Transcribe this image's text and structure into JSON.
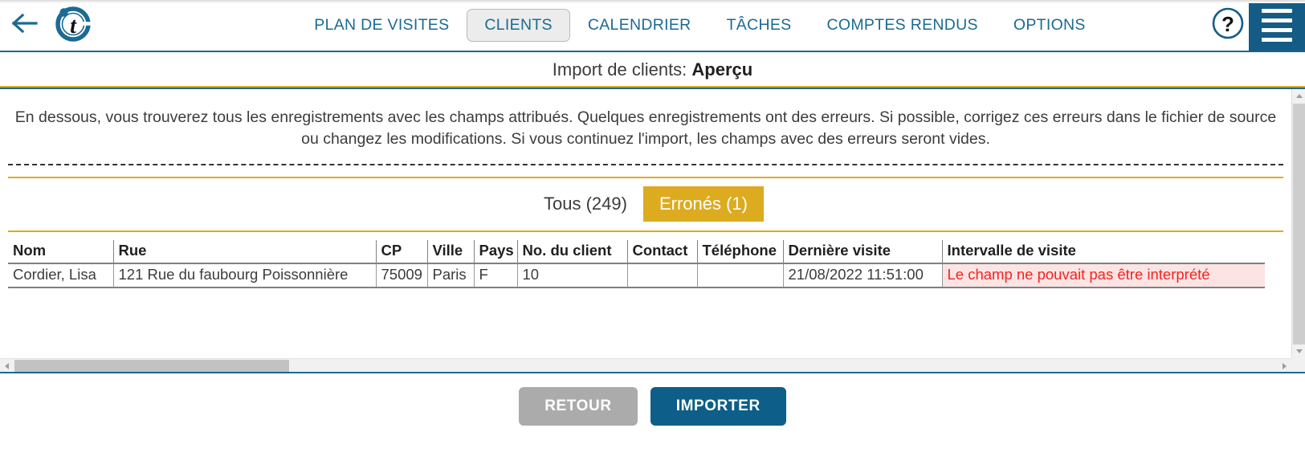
{
  "header": {
    "back_icon": "arrow-left-icon",
    "logo_icon": "brand-t-logo-icon",
    "nav": [
      {
        "label": "PLAN DE VISITES",
        "active": false
      },
      {
        "label": "CLIENTS",
        "active": true
      },
      {
        "label": "CALENDRIER",
        "active": false
      },
      {
        "label": "TÂCHES",
        "active": false
      },
      {
        "label": "COMPTES RENDUS",
        "active": false
      },
      {
        "label": "OPTIONS",
        "active": false
      }
    ],
    "help_icon": "question-mark-circle-icon",
    "menu_icon": "hamburger-menu-icon",
    "colors": {
      "nav_link": "#1b6a93",
      "menu_bg": "#145c85",
      "accent_rule": "#1b6a93"
    }
  },
  "page": {
    "title_prefix": "Import de clients: ",
    "title_emphasis": "Aperçu"
  },
  "intro": {
    "text": "En dessous, vous trouverez tous les enregistrements avec les champs attribués. Quelques enregistrements ont des erreurs. Si possible, corrigez ces erreurs dans le fichier de source ou changez les modifications. Si vous continuez l'import, les champs avec des erreurs seront vides."
  },
  "tabs": [
    {
      "label": "Tous (249)",
      "active": false
    },
    {
      "label": "Erronés (1)",
      "active": true
    }
  ],
  "table": {
    "columns": [
      "Nom",
      "Rue",
      "CP",
      "Ville",
      "Pays",
      "No. du client",
      "Contact",
      "Téléphone",
      "Dernière visite",
      "Intervalle de visite"
    ],
    "rows": [
      {
        "nom": "Cordier, Lisa",
        "rue": "121 Rue du faubourg Poissonnière",
        "cp": "75009",
        "ville": "Paris",
        "pays": "F",
        "no_client": "10",
        "contact": "",
        "telephone": "",
        "derniere_visite": "21/08/2022 11:51:00",
        "intervalle_visite": "Le champ ne pouvait pas être interprété",
        "intervalle_is_error": true
      }
    ]
  },
  "footer": {
    "back_label": "RETOUR",
    "import_label": "IMPORTER",
    "colors": {
      "back_bg": "#ababab",
      "import_bg": "#0d5e88"
    }
  },
  "theme": {
    "gold": "#ddab20",
    "error_text": "#f5231f",
    "error_bg": "#fce4e4"
  }
}
